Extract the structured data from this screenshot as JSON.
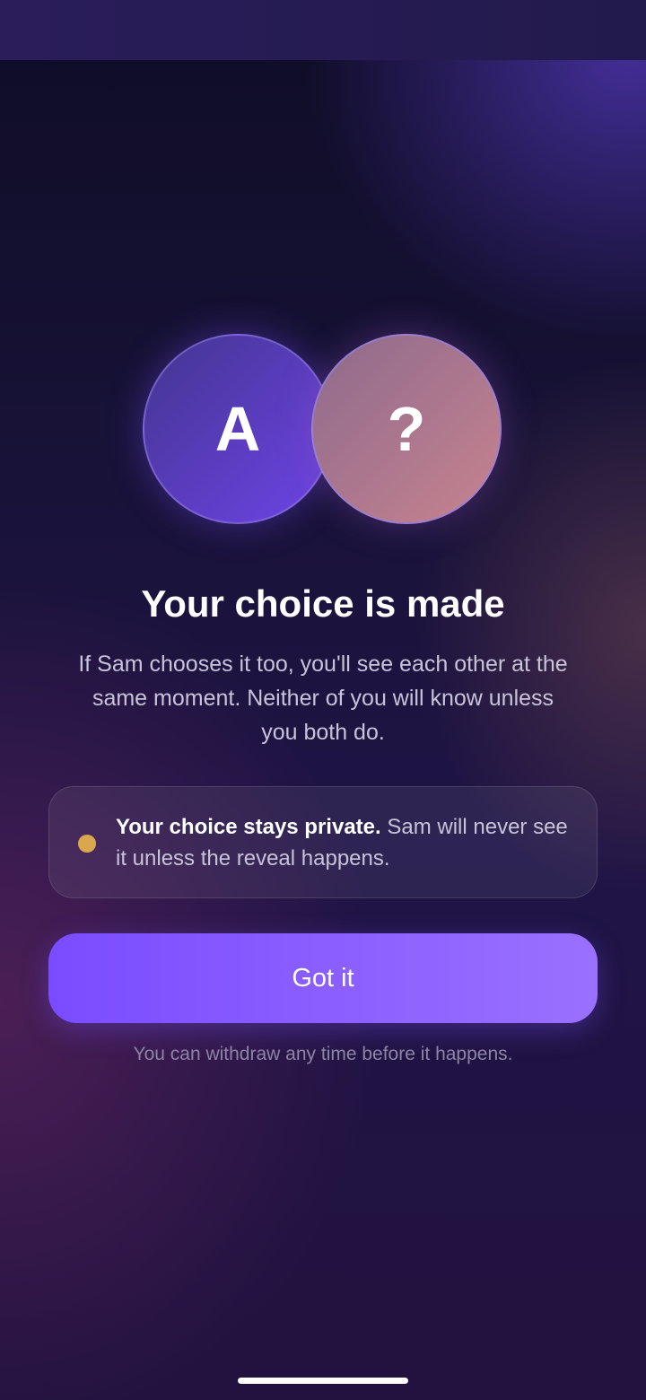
{
  "avatars": {
    "left_initial": "A",
    "right_initial": "?"
  },
  "title": "Your choice is made",
  "subtitle": "If Sam chooses it too, you'll see each other at the same moment. Neither of you will know unless you both do.",
  "notice": {
    "bold": "Your choice stays private.",
    "text": " Sam will never see it unless the reveal happens.",
    "dot_color": "#d9a84e"
  },
  "primary_button": {
    "label": "Got it",
    "color": "#8a5cff"
  },
  "footnote": "You can withdraw any time before it happens."
}
